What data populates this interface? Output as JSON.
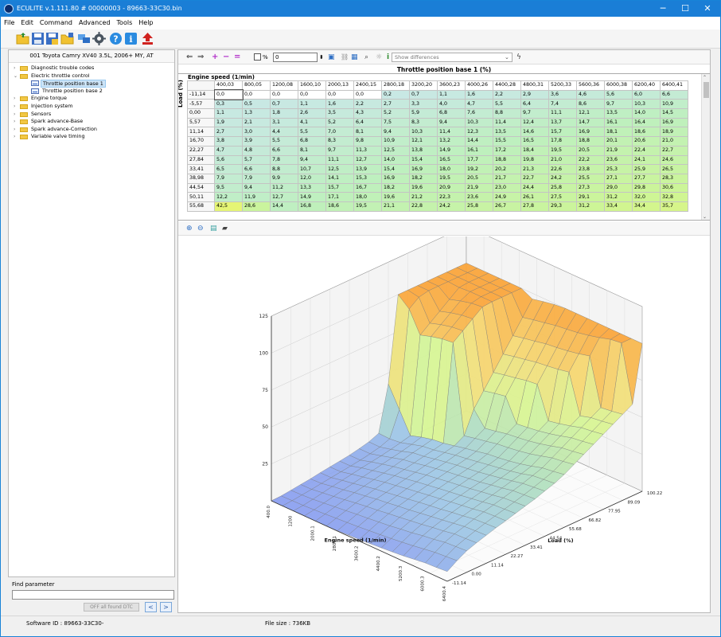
{
  "window": {
    "title": "ECULITE v.1.111.80  # 00000003 - 89663-33C30.bin",
    "min": "─",
    "max": "☐",
    "close": "✕"
  },
  "menu": [
    "File",
    "Edit",
    "Command",
    "Advanced",
    "Tools",
    "Help"
  ],
  "vehicle": "001 Toyota Camry XV40 3.5L, 2006+ MY, AT",
  "tree": [
    {
      "label": "Diagnostic trouble codes",
      "level": 0,
      "type": "folder",
      "expanded": false
    },
    {
      "label": "Electric throttle control",
      "level": 0,
      "type": "folder",
      "expanded": true
    },
    {
      "label": "Throttle position base 1",
      "level": 1,
      "type": "map",
      "selected": true
    },
    {
      "label": "Throttle position base 2",
      "level": 1,
      "type": "map"
    },
    {
      "label": "Engine torque",
      "level": 0,
      "type": "folder",
      "expanded": false
    },
    {
      "label": "Injection system",
      "level": 0,
      "type": "folder",
      "expanded": false
    },
    {
      "label": "Sensors",
      "level": 0,
      "type": "folder",
      "expanded": false
    },
    {
      "label": "Spark advance-Base",
      "level": 0,
      "type": "folder",
      "expanded": false
    },
    {
      "label": "Spark advance-Correction",
      "level": 0,
      "type": "folder",
      "expanded": false
    },
    {
      "label": "Variable valve timing",
      "level": 0,
      "type": "folder",
      "expanded": false
    }
  ],
  "find": {
    "label": "Find parameter",
    "value": "",
    "off_btn": "OFF all found DTC",
    "prev": "<",
    "next": ">"
  },
  "maptoolbar": {
    "percent_label": "%",
    "value": "0",
    "diff_placeholder": "Show differences"
  },
  "map": {
    "title": "Throttle position base 1 (%)",
    "x_axis": "Engine speed (1/min)",
    "y_axis": "Load (%)",
    "cols": [
      "400,03",
      "800,05",
      "1200,08",
      "1600,10",
      "2000,13",
      "2400,15",
      "2800,18",
      "3200,20",
      "3600,23",
      "4000,26",
      "4400,28",
      "4800,31",
      "5200,33",
      "5600,36",
      "6000,38",
      "6200,40",
      "6400,41"
    ],
    "rows": [
      {
        "h": "-11,14",
        "v": [
          "0,0",
          "0,0",
          "0,0",
          "0,0",
          "0,0",
          "0,0",
          "0,2",
          "0,7",
          "1,1",
          "1,6",
          "2,2",
          "2,9",
          "3,6",
          "4,6",
          "5,6",
          "6,0",
          "6,6"
        ]
      },
      {
        "h": "-5,57",
        "v": [
          "0,3",
          "0,5",
          "0,7",
          "1,1",
          "1,6",
          "2,2",
          "2,7",
          "3,3",
          "4,0",
          "4,7",
          "5,5",
          "6,4",
          "7,4",
          "8,6",
          "9,7",
          "10,3",
          "10,9"
        ]
      },
      {
        "h": "0,00",
        "v": [
          "1,1",
          "1,3",
          "1,8",
          "2,6",
          "3,5",
          "4,3",
          "5,2",
          "5,9",
          "6,8",
          "7,6",
          "8,8",
          "9,7",
          "11,1",
          "12,1",
          "13,5",
          "14,0",
          "14,5"
        ]
      },
      {
        "h": "5,57",
        "v": [
          "1,9",
          "2,1",
          "3,1",
          "4,1",
          "5,2",
          "6,4",
          "7,5",
          "8,3",
          "9,4",
          "10,3",
          "11,4",
          "12,4",
          "13,7",
          "14,7",
          "16,1",
          "16,4",
          "16,9"
        ]
      },
      {
        "h": "11,14",
        "v": [
          "2,7",
          "3,0",
          "4,4",
          "5,5",
          "7,0",
          "8,1",
          "9,4",
          "10,3",
          "11,4",
          "12,3",
          "13,5",
          "14,6",
          "15,7",
          "16,9",
          "18,1",
          "18,6",
          "18,9"
        ]
      },
      {
        "h": "16,70",
        "v": [
          "3,8",
          "3,9",
          "5,5",
          "6,8",
          "8,3",
          "9,8",
          "10,9",
          "12,1",
          "13,2",
          "14,4",
          "15,5",
          "16,5",
          "17,8",
          "18,8",
          "20,1",
          "20,6",
          "21,0"
        ]
      },
      {
        "h": "22,27",
        "v": [
          "4,7",
          "4,8",
          "6,6",
          "8,1",
          "9,7",
          "11,3",
          "12,5",
          "13,8",
          "14,9",
          "16,1",
          "17,2",
          "18,4",
          "19,5",
          "20,5",
          "21,9",
          "22,4",
          "22,7"
        ]
      },
      {
        "h": "27,84",
        "v": [
          "5,6",
          "5,7",
          "7,8",
          "9,4",
          "11,1",
          "12,7",
          "14,0",
          "15,4",
          "16,5",
          "17,7",
          "18,8",
          "19,8",
          "21,0",
          "22,2",
          "23,6",
          "24,1",
          "24,6"
        ]
      },
      {
        "h": "33,41",
        "v": [
          "6,5",
          "6,6",
          "8,8",
          "10,7",
          "12,5",
          "13,9",
          "15,4",
          "16,9",
          "18,0",
          "19,2",
          "20,2",
          "21,3",
          "22,6",
          "23,8",
          "25,3",
          "25,9",
          "26,5"
        ]
      },
      {
        "h": "38,98",
        "v": [
          "7,9",
          "7,9",
          "9,9",
          "12,0",
          "14,1",
          "15,3",
          "16,9",
          "18,2",
          "19,5",
          "20,5",
          "21,7",
          "22,7",
          "24,2",
          "25,5",
          "27,1",
          "27,7",
          "28,3"
        ]
      },
      {
        "h": "44,54",
        "v": [
          "9,5",
          "9,4",
          "11,2",
          "13,3",
          "15,7",
          "16,7",
          "18,2",
          "19,6",
          "20,9",
          "21,9",
          "23,0",
          "24,4",
          "25,8",
          "27,3",
          "29,0",
          "29,8",
          "30,6"
        ]
      },
      {
        "h": "50,11",
        "v": [
          "12,2",
          "11,9",
          "12,7",
          "14,9",
          "17,1",
          "18,0",
          "19,6",
          "21,2",
          "22,3",
          "23,6",
          "24,9",
          "26,1",
          "27,5",
          "29,1",
          "31,2",
          "32,0",
          "32,8"
        ]
      },
      {
        "h": "55,68",
        "v": [
          "42,5",
          "28,6",
          "14,4",
          "16,8",
          "18,6",
          "19,5",
          "21,1",
          "22,8",
          "24,2",
          "25,8",
          "26,7",
          "27,8",
          "29,3",
          "31,2",
          "33,4",
          "34,4",
          "35,7"
        ]
      }
    ]
  },
  "plot3d": {
    "z_ticks": [
      "125",
      "100",
      "75",
      "50",
      "25"
    ],
    "x_ticks": [
      "400.0",
      "1200",
      "2000.1",
      "2800.1",
      "3600.2",
      "4400.2",
      "5200.3",
      "6000.3",
      "6400.4"
    ],
    "y_ticks": [
      "-11.14",
      "0.00",
      "11.14",
      "22.27",
      "33.41",
      "44.54",
      "55.68",
      "66.82",
      "77.95",
      "89.09",
      "100.22"
    ],
    "x_label": "Engine speed (1/min)",
    "y_label": "Load (%)"
  },
  "status": {
    "software_id": "Software ID :  89663-33C30-",
    "file_size": "File size :  736KB"
  }
}
